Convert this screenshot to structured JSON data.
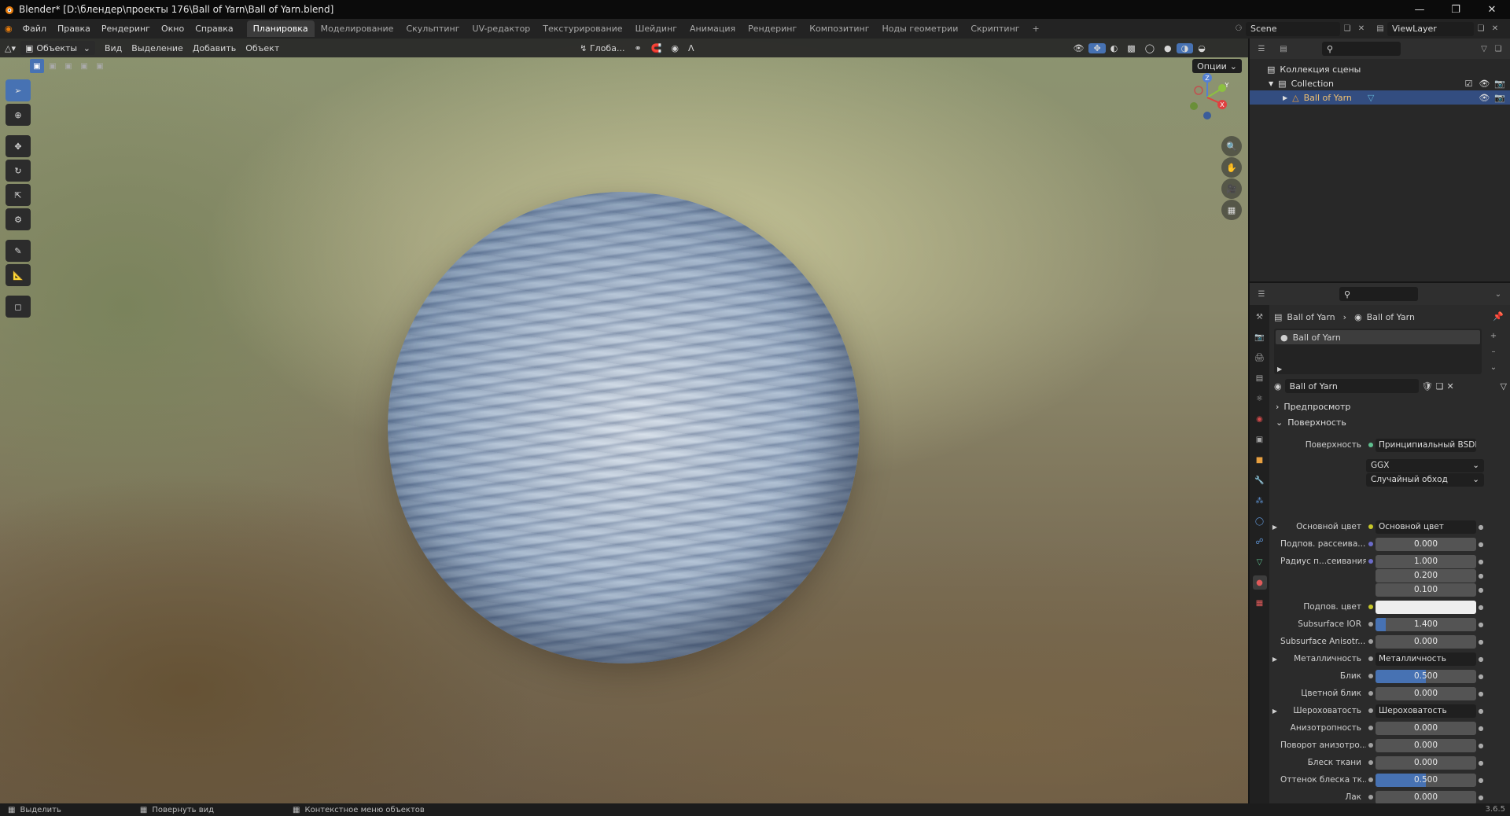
{
  "window": {
    "title": "Blender* [D:\\блендер\\проекты 176\\Ball of Yarn\\Ball of Yarn.blend]"
  },
  "menu": [
    "Файл",
    "Правка",
    "Рендеринг",
    "Окно",
    "Справка"
  ],
  "workspaces": [
    "Планировка",
    "Моделирование",
    "Скульптинг",
    "UV-редактор",
    "Текстурирование",
    "Шейдинг",
    "Анимация",
    "Рендеринг",
    "Композитинг",
    "Ноды геометрии",
    "Скриптинг",
    "+"
  ],
  "scene": {
    "name": "Scene",
    "view_layer": "ViewLayer"
  },
  "viewport": {
    "mode": "Объекты",
    "menus": [
      "Вид",
      "Выделение",
      "Добавить",
      "Объект"
    ],
    "orientation": "Глоба...",
    "options_label": "Опции",
    "gizmo": {
      "z": "Z",
      "y": "Y",
      "x": "X"
    }
  },
  "outliner": {
    "scene_collection": "Коллекция сцены",
    "collection": "Collection",
    "object": "Ball of Yarn"
  },
  "properties": {
    "breadcrumb": [
      "Ball of Yarn",
      "Ball of Yarn"
    ],
    "slot": "Ball of Yarn",
    "material_name": "Ball of Yarn",
    "sections": {
      "preview": "Предпросмотр",
      "surface": "Поверхность"
    },
    "surface_label": "Поверхность",
    "surface_value": "Принципиальный BSDF",
    "distribution": "GGX",
    "subsurface_method": "Случайный обход",
    "rows": [
      {
        "label": "Основной цвет",
        "type": "link",
        "value": "Основной цвет",
        "dot": "#c7c729",
        "expand": true
      },
      {
        "label": "Подпов. рассеива...",
        "type": "num",
        "value": "0.000",
        "dot": "#6b6bc9",
        "fill": 0
      },
      {
        "label": "Радиус п...сеивания",
        "type": "num",
        "value": "1.000",
        "dot": "#6b6bc9",
        "fill": 0
      },
      {
        "label": "",
        "type": "num",
        "value": "0.200",
        "dot": "",
        "fill": 0
      },
      {
        "label": "",
        "type": "num",
        "value": "0.100",
        "dot": "",
        "fill": 0
      },
      {
        "label": "Подпов. цвет",
        "type": "color",
        "value": "",
        "dot": "#c7c729",
        "color": "#eeeeee"
      },
      {
        "label": "Subsurface IOR",
        "type": "num",
        "value": "1.400",
        "dot": "#a0a0a0",
        "fill": 0.1
      },
      {
        "label": "Subsurface Anisotr...",
        "type": "num",
        "value": "0.000",
        "dot": "#a0a0a0",
        "fill": 0
      },
      {
        "label": "Металличность",
        "type": "link",
        "value": "Металличность",
        "dot": "#a0a0a0",
        "expand": true
      },
      {
        "label": "Блик",
        "type": "num",
        "value": "0.500",
        "dot": "#a0a0a0",
        "fill": 0.5
      },
      {
        "label": "Цветной блик",
        "type": "num",
        "value": "0.000",
        "dot": "#a0a0a0",
        "fill": 0
      },
      {
        "label": "Шероховатость",
        "type": "link",
        "value": "Шероховатость",
        "dot": "#a0a0a0",
        "expand": true
      },
      {
        "label": "Анизотропность",
        "type": "num",
        "value": "0.000",
        "dot": "#a0a0a0",
        "fill": 0
      },
      {
        "label": "Поворот анизотро...",
        "type": "num",
        "value": "0.000",
        "dot": "#a0a0a0",
        "fill": 0
      },
      {
        "label": "Блеск ткани",
        "type": "num",
        "value": "0.000",
        "dot": "#a0a0a0",
        "fill": 0
      },
      {
        "label": "Оттенок блеска тк...",
        "type": "num",
        "value": "0.500",
        "dot": "#a0a0a0",
        "fill": 0.5
      },
      {
        "label": "Лак",
        "type": "num",
        "value": "0.000",
        "dot": "#a0a0a0",
        "fill": 0
      }
    ]
  },
  "status": {
    "select": "Выделить",
    "rotate": "Повернуть вид",
    "context": "Контекстное меню объектов",
    "version": "3.6.5"
  }
}
